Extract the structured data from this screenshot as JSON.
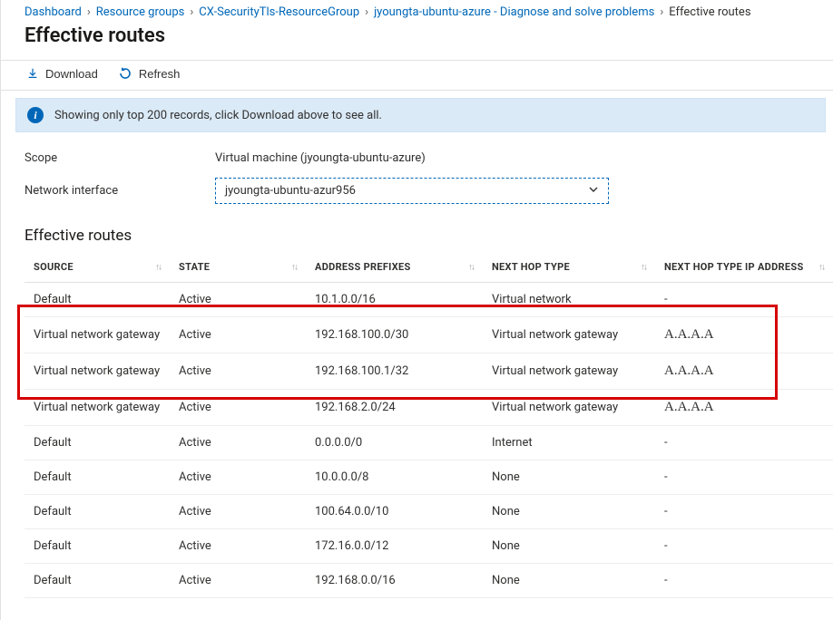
{
  "breadcrumb": {
    "items": [
      {
        "label": "Dashboard"
      },
      {
        "label": "Resource groups"
      },
      {
        "label": "CX-SecurityTls-ResourceGroup"
      },
      {
        "label": "jyoungta-ubuntu-azure - Diagnose and solve problems"
      }
    ],
    "current": "Effective routes"
  },
  "page_title": "Effective routes",
  "toolbar": {
    "download_label": "Download",
    "refresh_label": "Refresh"
  },
  "info": {
    "message": "Showing only top 200 records, click Download above to see all."
  },
  "form": {
    "scope_label": "Scope",
    "scope_value": "Virtual machine (jyoungta-ubuntu-azure)",
    "nic_label": "Network interface",
    "nic_value": "jyoungta-ubuntu-azur956"
  },
  "section_title": "Effective routes",
  "table": {
    "columns": {
      "source": "Source",
      "state": "State",
      "address_prefixes": "Address Prefixes",
      "next_hop_type": "Next Hop Type",
      "next_hop_ip": "Next Hop Type IP Address"
    },
    "rows": [
      {
        "source": "Default",
        "state": "Active",
        "prefix": "10.1.0.0/16",
        "hoptype": "Virtual network",
        "hopip": "-"
      },
      {
        "source": "Virtual network gateway",
        "state": "Active",
        "prefix": "192.168.100.0/30",
        "hoptype": "Virtual network gateway",
        "hopip": "A.A.A.A",
        "highlighted": true
      },
      {
        "source": "Virtual network gateway",
        "state": "Active",
        "prefix": "192.168.100.1/32",
        "hoptype": "Virtual network gateway",
        "hopip": "A.A.A.A",
        "highlighted": true
      },
      {
        "source": "Virtual network gateway",
        "state": "Active",
        "prefix": "192.168.2.0/24",
        "hoptype": "Virtual network gateway",
        "hopip": "A.A.A.A",
        "highlighted": true
      },
      {
        "source": "Default",
        "state": "Active",
        "prefix": "0.0.0.0/0",
        "hoptype": "Internet",
        "hopip": "-"
      },
      {
        "source": "Default",
        "state": "Active",
        "prefix": "10.0.0.0/8",
        "hoptype": "None",
        "hopip": "-"
      },
      {
        "source": "Default",
        "state": "Active",
        "prefix": "100.64.0.0/10",
        "hoptype": "None",
        "hopip": "-"
      },
      {
        "source": "Default",
        "state": "Active",
        "prefix": "172.16.0.0/12",
        "hoptype": "None",
        "hopip": "-"
      },
      {
        "source": "Default",
        "state": "Active",
        "prefix": "192.168.0.0/16",
        "hoptype": "None",
        "hopip": "-"
      }
    ]
  }
}
